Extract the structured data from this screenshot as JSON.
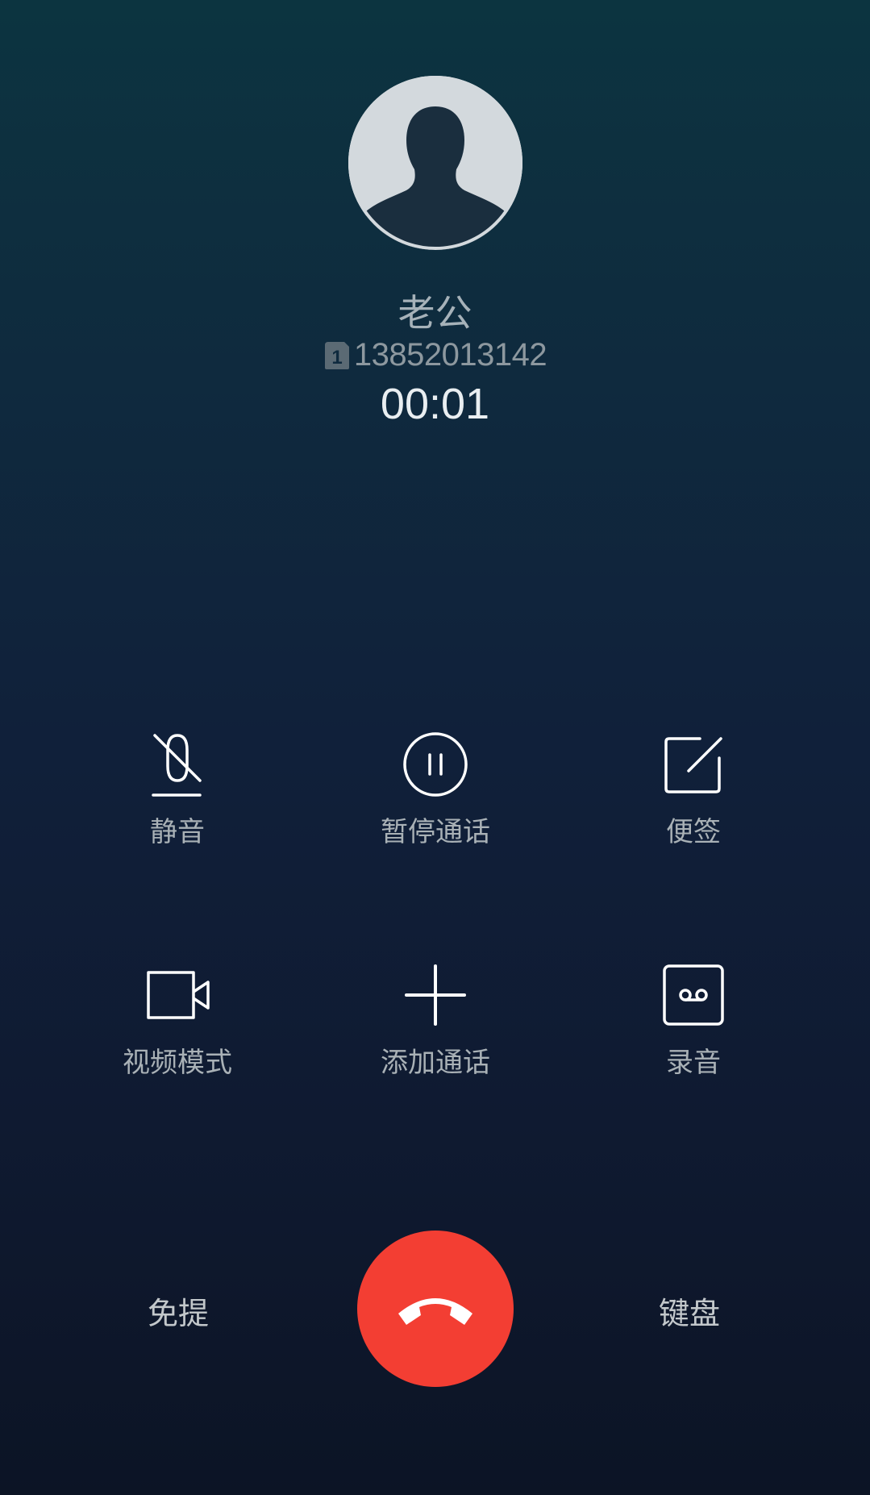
{
  "contact": {
    "name": "老公",
    "sim_slot": "1",
    "number": "13852013142",
    "timer": "00:01"
  },
  "controls": {
    "mute": {
      "label": "静音",
      "icon": "mic-off-icon"
    },
    "hold": {
      "label": "暂停通话",
      "icon": "pause-circle-icon"
    },
    "notes": {
      "label": "便签",
      "icon": "note-edit-icon"
    },
    "video": {
      "label": "视频模式",
      "icon": "video-camera-icon"
    },
    "add_call": {
      "label": "添加通话",
      "icon": "plus-icon"
    },
    "record": {
      "label": "录音",
      "icon": "record-tape-icon"
    }
  },
  "bottom": {
    "speaker_label": "免提",
    "keypad_label": "键盘",
    "hangup_icon": "phone-hangup-icon"
  },
  "colors": {
    "hangup": "#f33e33",
    "background_top": "#0c3440",
    "background_bottom": "#0c1425"
  }
}
